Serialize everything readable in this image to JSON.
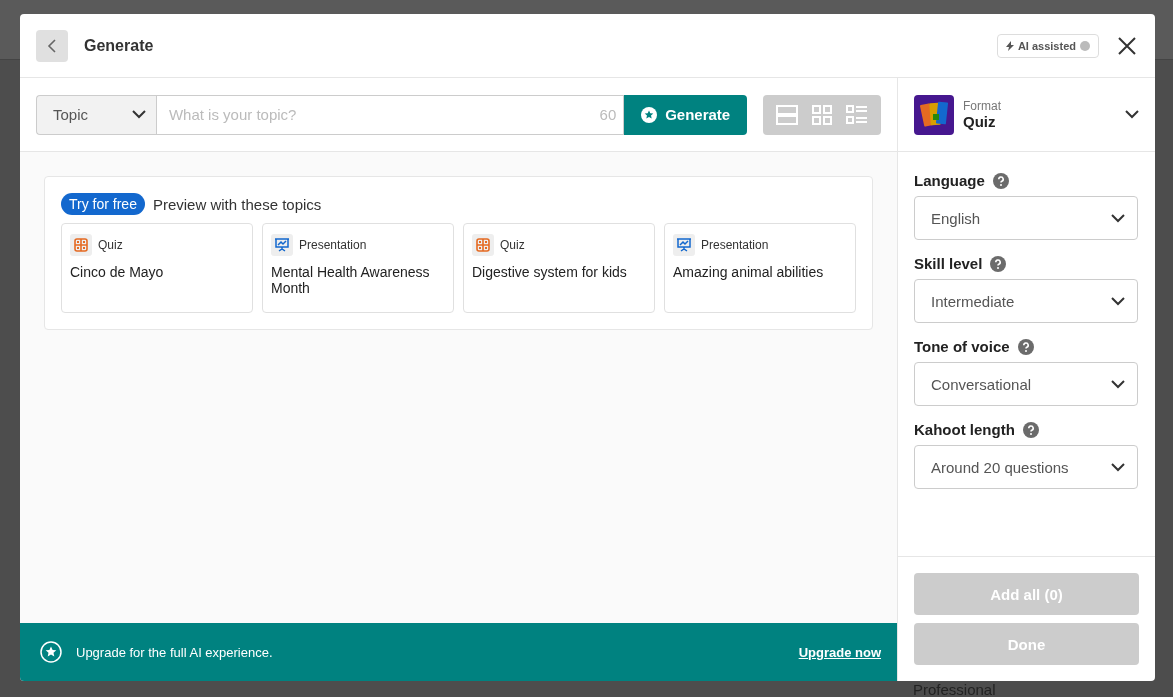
{
  "header": {
    "title": "Generate",
    "badge": "AI assisted"
  },
  "topic_bar": {
    "type_select": "Topic",
    "placeholder": "What is your topic?",
    "char_count": "60",
    "generate_button": "Generate"
  },
  "preview": {
    "badge": "Try for free",
    "heading": "Preview with these topics",
    "topics": [
      {
        "kind": "quiz",
        "type_label": "Quiz",
        "title": "Cinco de Mayo"
      },
      {
        "kind": "presentation",
        "type_label": "Presentation",
        "title": "Mental Health Awareness Month"
      },
      {
        "kind": "quiz",
        "type_label": "Quiz",
        "title": "Digestive system for kids"
      },
      {
        "kind": "presentation",
        "type_label": "Presentation",
        "title": "Amazing animal abilities"
      }
    ]
  },
  "format": {
    "label": "Format",
    "value": "Quiz"
  },
  "settings": [
    {
      "label": "Language",
      "value": "English"
    },
    {
      "label": "Skill level",
      "value": "Intermediate"
    },
    {
      "label": "Tone of voice",
      "value": "Conversational"
    },
    {
      "label": "Kahoot length",
      "value": "Around 20 questions"
    }
  ],
  "buttons": [
    {
      "label": "Add all (0)",
      "disabled": true
    },
    {
      "label": "Done",
      "disabled": true
    }
  ],
  "footer": {
    "message": "Upgrade for the full AI experience.",
    "link": "Upgrade now"
  },
  "background": {
    "plan_label": "Professional"
  }
}
